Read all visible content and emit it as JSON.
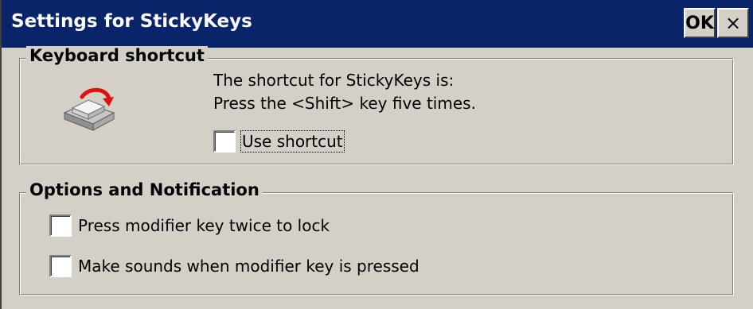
{
  "window": {
    "title": "Settings for StickyKeys",
    "ok_label": "OK",
    "close_label": "×"
  },
  "keyboard_shortcut": {
    "legend": "Keyboard shortcut",
    "line1": "The shortcut for StickyKeys is:",
    "line2": "Press the <Shift> key five times.",
    "icon": "keyboard-key-icon",
    "use_shortcut": {
      "label": "Use shortcut",
      "checked": false
    }
  },
  "options": {
    "legend": "Options and Notification",
    "items": [
      {
        "label": "Press modifier key twice to lock",
        "checked": false
      },
      {
        "label": "Make sounds when modifier key is pressed",
        "checked": false
      }
    ]
  },
  "colors": {
    "titlebar": "#0a246a",
    "face": "#d4d0c8",
    "arrow": "#e01010"
  }
}
